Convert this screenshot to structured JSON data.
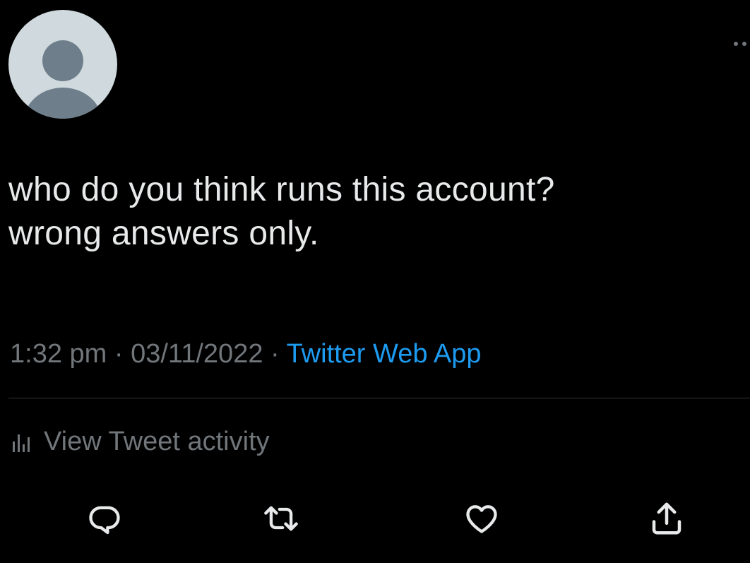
{
  "tweet": {
    "text_lines": [
      "who do you think runs this account?",
      "wrong answers only."
    ],
    "time": "1:32 pm",
    "separator": "·",
    "date": "03/11/2022",
    "source": "Twitter Web App"
  },
  "activity": {
    "label": "View Tweet activity",
    "icon": "bar-chart-icon"
  },
  "actions": [
    {
      "icon": "reply-icon"
    },
    {
      "icon": "retweet-icon"
    },
    {
      "icon": "like-icon"
    },
    {
      "icon": "share-icon"
    }
  ],
  "colors": {
    "background": "#000000",
    "text": "#e7e9ea",
    "secondary": "#71767b",
    "link": "#1d9bf0",
    "divider": "#2f3336",
    "avatar_bg": "#cfd9de",
    "avatar_fg": "#6e7f8b"
  }
}
